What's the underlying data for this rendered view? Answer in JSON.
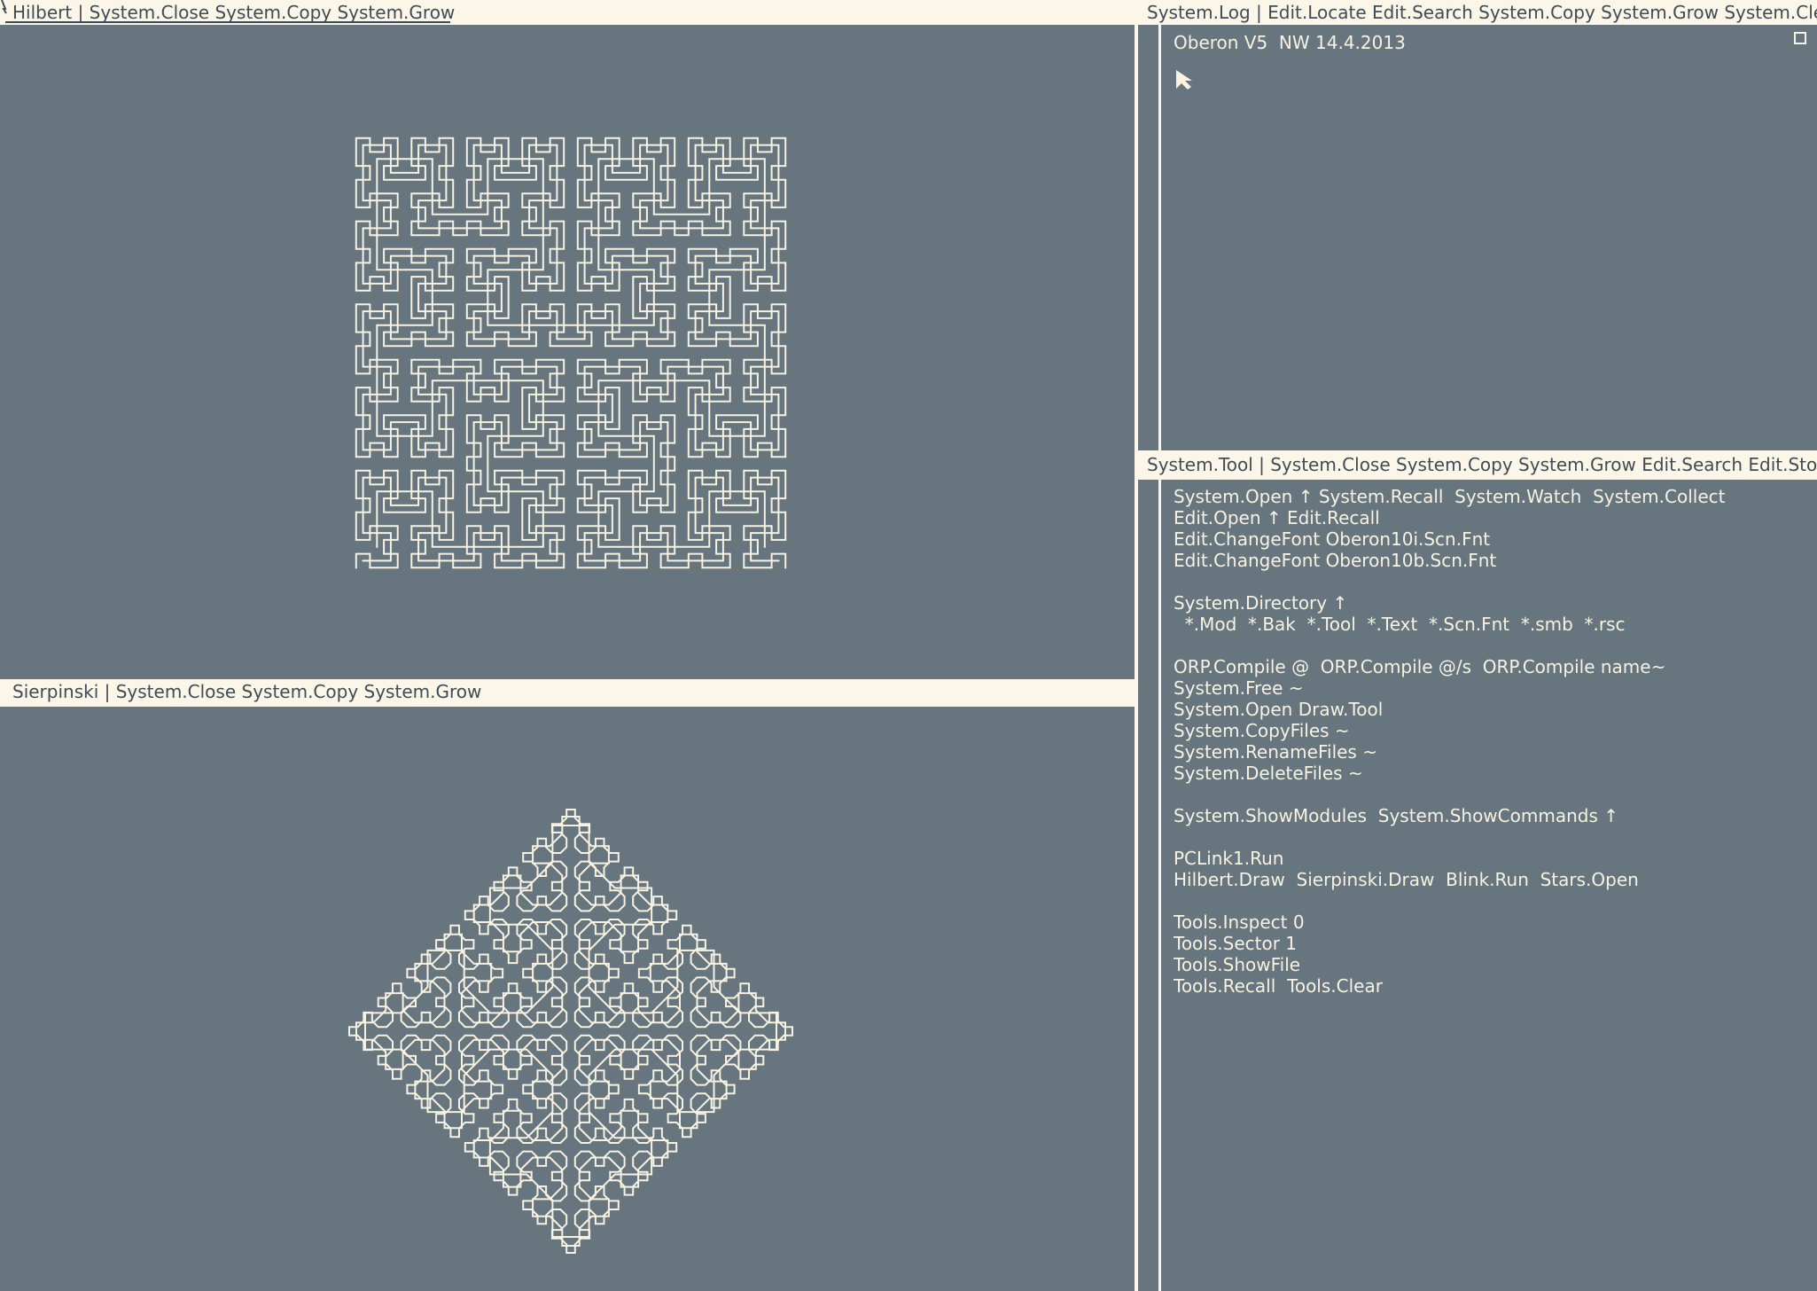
{
  "track_left": {
    "hilbert_viewer": {
      "menu": "Hilbert | System.Close  System.Copy  System.Grow"
    },
    "sierpinski_viewer": {
      "menu": "Sierpinski | System.Close  System.Copy  System.Grow"
    }
  },
  "track_right": {
    "log_viewer": {
      "menu": "System.Log | Edit.Locate Edit.Search System.Copy System.Grow System.Clear",
      "lines": [
        "Oberon V5  NW 14.4.2013"
      ]
    },
    "tool_viewer": {
      "menu": "System.Tool | System.Close System.Copy System.Grow Edit.Search Edit.Store",
      "lines": [
        "System.Open ↑ System.Recall  System.Watch  System.Collect",
        "Edit.Open ↑ Edit.Recall",
        "Edit.ChangeFont Oberon10i.Scn.Fnt",
        "Edit.ChangeFont Oberon10b.Scn.Fnt",
        "",
        "System.Directory ↑",
        "  *.Mod  *.Bak  *.Tool  *.Text  *.Scn.Fnt  *.smb  *.rsc",
        "",
        "ORP.Compile @  ORP.Compile @/s  ORP.Compile name~",
        "System.Free ~",
        "System.Open Draw.Tool",
        "System.CopyFiles ~",
        "System.RenameFiles ~",
        "System.DeleteFiles ~",
        "",
        "System.ShowModules  System.ShowCommands ↑",
        "",
        "PCLink1.Run",
        "Hilbert.Draw  Sierpinski.Draw  Blink.Run  Stars.Open",
        "",
        "Tools.Inspect 0",
        "Tools.Sector 1",
        "Tools.ShowFile",
        "Tools.Recall  Tools.Clear"
      ]
    }
  },
  "colors": {
    "background": "#66757e",
    "foreground": "#f7f2e2",
    "menu_background": "#fbf6e8",
    "menu_text": "#3f4c55"
  },
  "icons": {
    "mouse_pointer": "arrow-cursor-icon",
    "viewer_focus": "focus-square-icon"
  }
}
